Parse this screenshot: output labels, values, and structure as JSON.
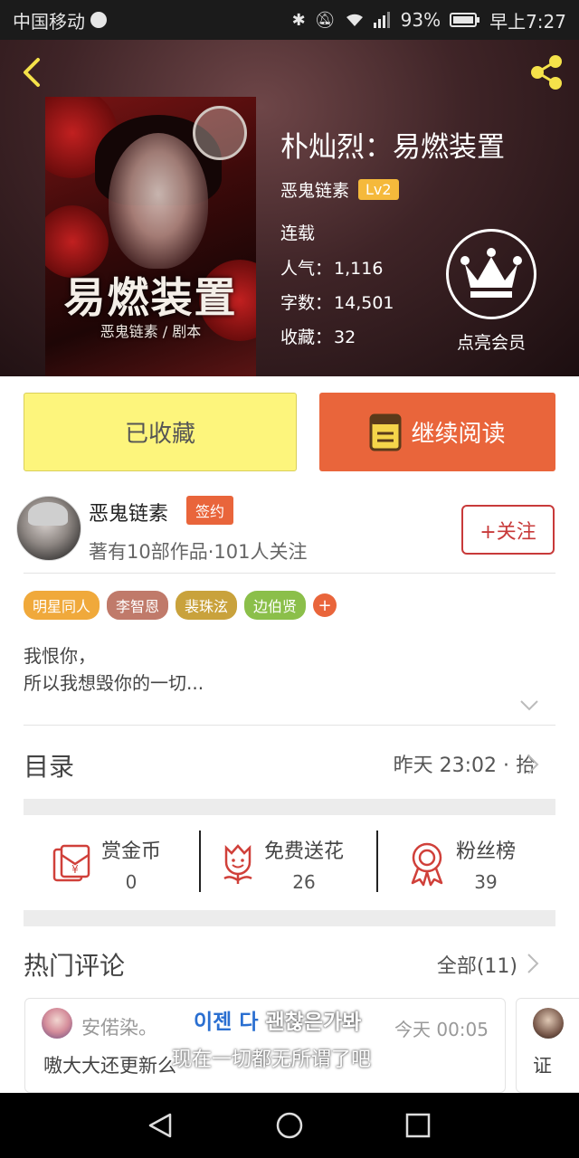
{
  "status_bar": {
    "carrier": "中国移动",
    "battery": "93%",
    "time": "早上7:27"
  },
  "header": {
    "back_icon": "back-arrow-icon",
    "share_icon": "share-icon"
  },
  "cover": {
    "title": "易燃装置",
    "subtitle": "恶鬼链素 / 剧本"
  },
  "book": {
    "title": "朴灿烈：易燃装置",
    "author": "恶鬼链素",
    "level": "Lv2",
    "status": "连载",
    "popularity_label": "人气：",
    "popularity": "1,116",
    "words_label": "字数：",
    "words": "14,501",
    "favorites_label": "收藏：",
    "favorites": "32"
  },
  "vip": {
    "label": "点亮会员",
    "icon": "crown-icon"
  },
  "actions": {
    "collected_label": "已收藏",
    "continue_label": "继续阅读"
  },
  "author_info": {
    "name": "恶鬼链素",
    "badge": "签约",
    "stats": "著有10部作品·101人关注",
    "follow_label": "+关注"
  },
  "tags": [
    {
      "label": "明星同人",
      "color": "#f0a93b"
    },
    {
      "label": "李智恩",
      "color": "#c07a6a"
    },
    {
      "label": "裴珠泫",
      "color": "#c9a23c"
    },
    {
      "label": "边伯贤",
      "color": "#8bbf4a"
    }
  ],
  "tag_more": "+",
  "intro": {
    "line1": "我恨你，",
    "line2": "所以我想毁你的一切..."
  },
  "toc": {
    "title": "目录",
    "update": "昨天 23:02 · 拾"
  },
  "rewards": [
    {
      "label": "赏金币",
      "value": "0",
      "icon": "red-envelope-icon"
    },
    {
      "label": "免费送花",
      "value": "26",
      "icon": "flower-icon"
    },
    {
      "label": "粉丝榜",
      "value": "39",
      "icon": "medal-icon"
    }
  ],
  "comments": {
    "title": "热门评论",
    "all_label": "全部(11)",
    "items": [
      {
        "user": "安偌染。",
        "time": "今天 00:05",
        "text": "嗷大大还更新么"
      },
      {
        "text": "证"
      }
    ]
  },
  "overlay": {
    "korean_blue": "이젠 다",
    "korean_rest": " 괜찮은가봐",
    "chinese": "现在一切都无所谓了吧"
  },
  "colors": {
    "accent": "#e9653b",
    "collected_bg": "#fdf57c",
    "icon_red": "#d0403a",
    "vip_badge": "#f5b93b"
  }
}
